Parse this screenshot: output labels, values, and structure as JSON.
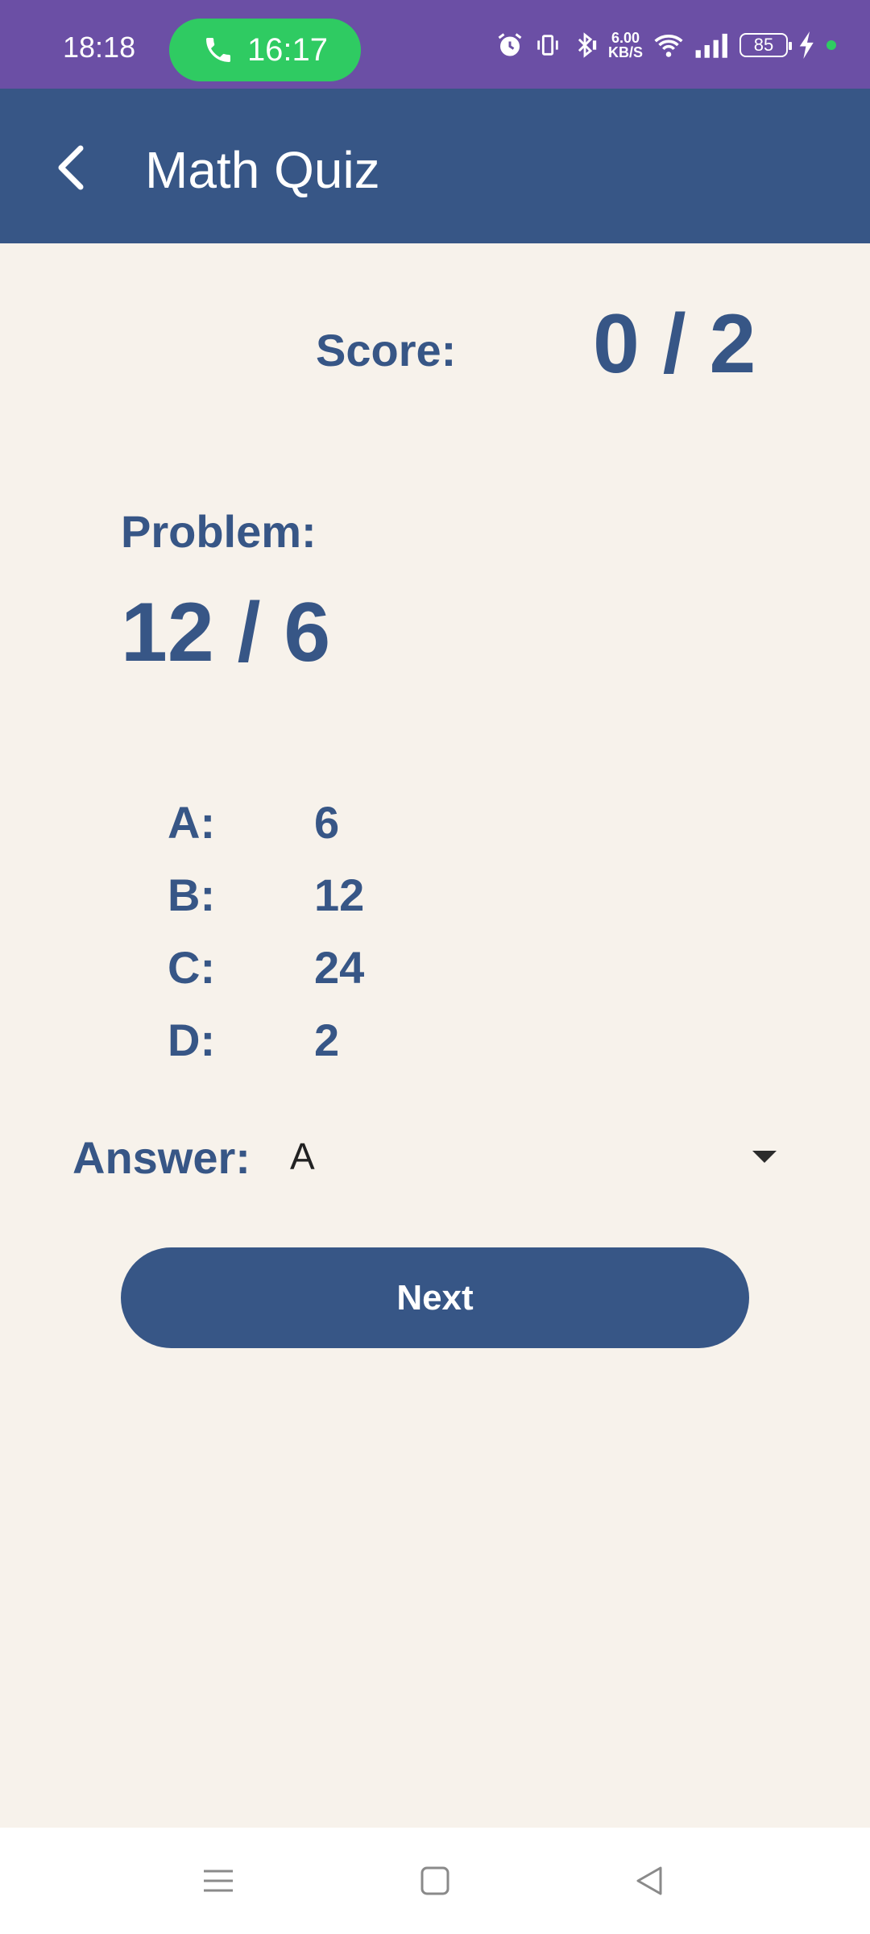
{
  "status_bar": {
    "time": "18:18",
    "call_time": "16:17",
    "net_speed_value": "6.00",
    "net_speed_unit": "KB/S",
    "battery": "85"
  },
  "app_bar": {
    "title": "Math Quiz"
  },
  "score": {
    "label": "Score:",
    "value": "0 / 2"
  },
  "problem": {
    "label": "Problem:",
    "value": "12 / 6"
  },
  "choices": [
    {
      "label": "A:",
      "value": "6"
    },
    {
      "label": "B:",
      "value": "12"
    },
    {
      "label": "C:",
      "value": "24"
    },
    {
      "label": "D:",
      "value": "2"
    }
  ],
  "answer": {
    "label": "Answer:",
    "selected": "A"
  },
  "next_button": {
    "label": "Next"
  },
  "colors": {
    "status_bar": "#6b4fa5",
    "app_bar": "#375686",
    "accent": "#375686",
    "background": "#f7f2eb",
    "call_pill": "#2fcb62"
  }
}
